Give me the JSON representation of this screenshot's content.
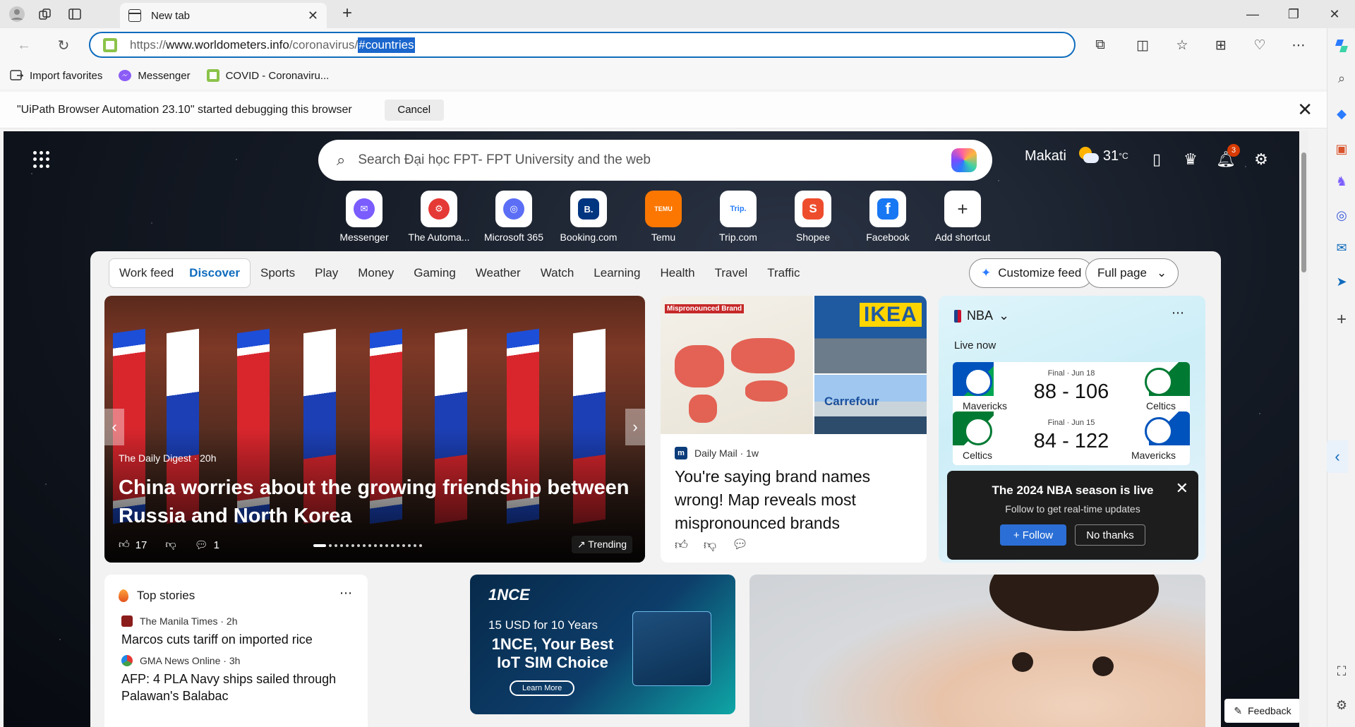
{
  "browser": {
    "tab_title": "New tab",
    "url_scheme": "https://",
    "url_host": "www.worldometers.info",
    "url_path": "/coronavirus/",
    "url_selected": "#countries",
    "favorites": [
      {
        "label": "Import favorites",
        "icon": "import-icon"
      },
      {
        "label": "Messenger",
        "icon": "messenger-icon"
      },
      {
        "label": "COVID - Coronaviru...",
        "icon": "worldometers-icon"
      }
    ],
    "debug_message": "\"UiPath Browser Automation 23.10\" started debugging this browser",
    "debug_cancel": "Cancel"
  },
  "newtab": {
    "search_placeholder": "Search Đại học FPT- FPT University and the web",
    "weather": {
      "city": "Makati",
      "temp": "31",
      "unit": "°C",
      "icon": "partly-sunny-icon"
    },
    "notifications_count": "3",
    "shortcuts": [
      {
        "label": "Messenger",
        "color": "#7a5cff",
        "glyph": "✉"
      },
      {
        "label": "The Automa...",
        "color": "#e53935",
        "glyph": "⚙"
      },
      {
        "label": "Microsoft 365",
        "color": "#5b6ef5",
        "glyph": "◎"
      },
      {
        "label": "Booking.com",
        "color": "#003580",
        "glyph": "B."
      },
      {
        "label": "Temu",
        "color": "#fb7701",
        "glyph": "TEMU"
      },
      {
        "label": "Trip.com",
        "color": "#ffffff",
        "glyph": "Trip."
      },
      {
        "label": "Shopee",
        "color": "#ee4d2d",
        "glyph": "S"
      },
      {
        "label": "Facebook",
        "color": "#1877f2",
        "glyph": "f"
      },
      {
        "label": "Add shortcut",
        "color": "#ffffff",
        "glyph": "+"
      }
    ]
  },
  "feed": {
    "pill_tabs": [
      "Work feed",
      "Discover"
    ],
    "active_tab": "Discover",
    "nav": [
      "Sports",
      "Play",
      "Money",
      "Gaming",
      "Weather",
      "Watch",
      "Learning",
      "Health",
      "Travel",
      "Traffic"
    ],
    "customize": "Customize feed",
    "layout": "Full page",
    "hero": {
      "source": "The Daily Digest · 20h",
      "title": "China worries about the growing friendship between Russia and North Korea",
      "likes": "17",
      "comments": "1",
      "trending": "Trending"
    },
    "map_article": {
      "source": "Daily Mail · 1w",
      "title": "You're saying brand names wrong! Map reveals most mispronounced brands",
      "map_tag": "Mispronounced Brand",
      "ikea_text": "IKEA",
      "carrefour_text": "Carrefour"
    },
    "nba": {
      "title": "NBA",
      "live": "Live now",
      "games": [
        {
          "meta": "Final · Jun 18",
          "home": "Mavericks",
          "away": "Celtics",
          "score": "88 - 106"
        },
        {
          "meta": "Final · Jun 15",
          "home": "Celtics",
          "away": "Mavericks",
          "score": "84 - 122"
        }
      ],
      "popup_title": "The 2024 NBA season is live",
      "popup_sub": "Follow to get real-time updates",
      "follow": "+ Follow",
      "no_thanks": "No thanks"
    },
    "top_stories": {
      "title": "Top stories",
      "items": [
        {
          "source": "The Manila Times · 2h",
          "title": "Marcos cuts tariff on imported rice"
        },
        {
          "source": "GMA News Online · 3h",
          "title": "AFP: 4 PLA Navy ships sailed through Palawan's Balabac"
        }
      ]
    },
    "ad": {
      "brand": "1NCE",
      "line1": "15 USD for 10 Years",
      "line2": "1NCE, Your Best IoT SIM Choice",
      "cta": "Learn More"
    },
    "feedback": "Feedback"
  }
}
